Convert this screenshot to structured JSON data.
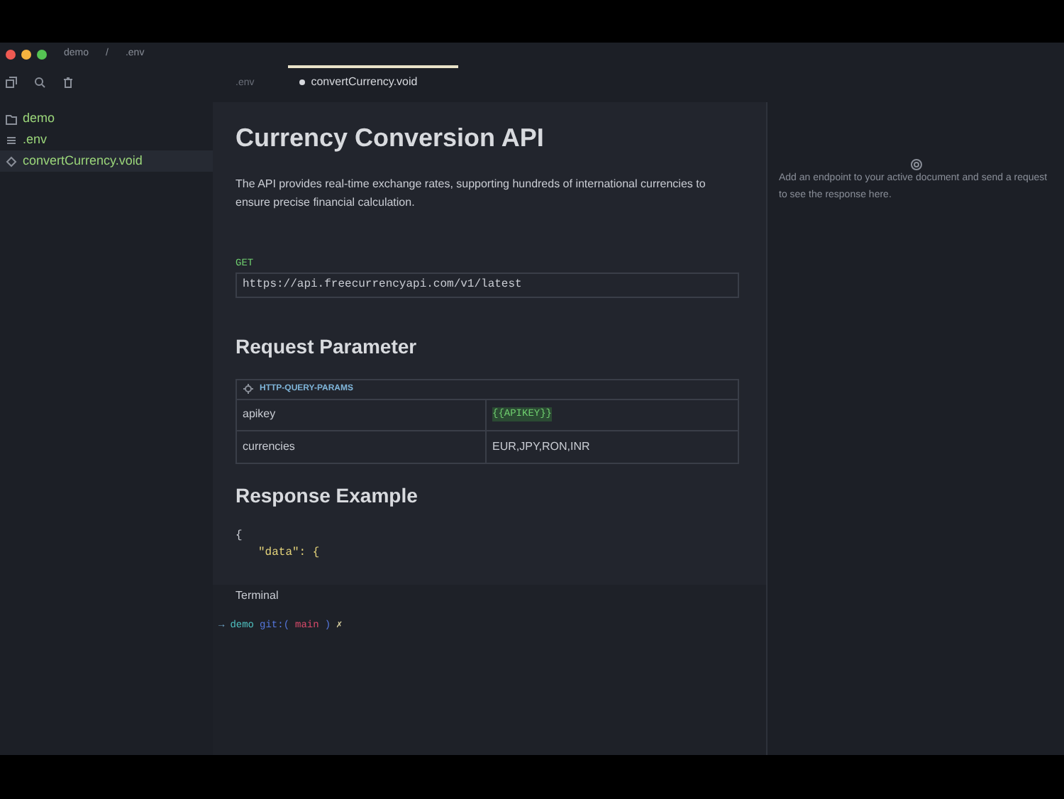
{
  "breadcrumb": [
    "demo",
    "/",
    ".env"
  ],
  "tabs": [
    {
      "label": ".env",
      "selected": false
    },
    {
      "label": "convertCurrency.void",
      "selected": true
    }
  ],
  "sidebar": {
    "items": [
      {
        "name": "demo",
        "kind": "folder",
        "selected": false
      },
      {
        "name": ".env",
        "kind": "env",
        "selected": false
      },
      {
        "name": "convertCurrency.void",
        "kind": "void",
        "selected": true
      }
    ]
  },
  "doc": {
    "title": "Currency Conversion API",
    "description": "The API provides real-time exchange rates, supporting hundreds of international currencies to ensure precise financial calculation.",
    "method": "GET",
    "url": "https://api.freecurrencyapi.com/v1/latest",
    "params_heading": "Request Parameter",
    "params_block": "HTTP-QUERY-PARAMS",
    "params": [
      {
        "name": "apikey",
        "value": "{{APIKEY}}",
        "kind": "variable"
      },
      {
        "name": "currencies",
        "value": "EUR,JPY,RON,INR",
        "kind": "plain"
      }
    ],
    "response_heading": "Response Example",
    "code_lines": [
      "{",
      "\"data\": {"
    ]
  },
  "terminal": {
    "title": "Terminal",
    "prompt": [
      "→",
      "demo",
      "git:(",
      "main",
      ")",
      "✗"
    ]
  },
  "response_panel": {
    "message": "Add an endpoint to your active document and send a request to see the response here."
  }
}
